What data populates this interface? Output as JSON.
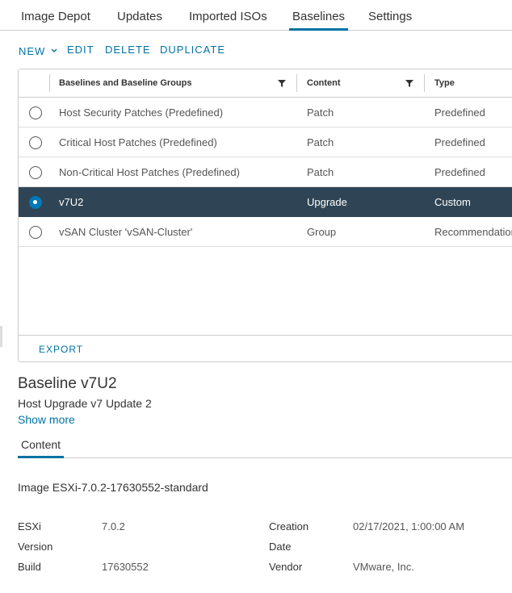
{
  "tabs": [
    {
      "label": "Image Depot",
      "active": false
    },
    {
      "label": "Updates",
      "active": false
    },
    {
      "label": "Imported ISOs",
      "active": false
    },
    {
      "label": "Baselines",
      "active": true
    },
    {
      "label": "Settings",
      "active": false
    }
  ],
  "toolbar": {
    "new_label": "NEW",
    "edit_label": "EDIT",
    "delete_label": "DELETE",
    "duplicate_label": "DUPLICATE"
  },
  "grid": {
    "columns": [
      "Baselines and Baseline Groups",
      "Content",
      "Type"
    ],
    "rows": [
      {
        "name": "Host Security Patches (Predefined)",
        "content": "Patch",
        "type": "Predefined",
        "selected": false
      },
      {
        "name": "Critical Host Patches (Predefined)",
        "content": "Patch",
        "type": "Predefined",
        "selected": false
      },
      {
        "name": "Non-Critical Host Patches (Predefined)",
        "content": "Patch",
        "type": "Predefined",
        "selected": false
      },
      {
        "name": "v7U2",
        "content": "Upgrade",
        "type": "Custom",
        "selected": true
      },
      {
        "name": "vSAN Cluster 'vSAN-Cluster'",
        "content": "Group",
        "type": "Recommendation",
        "selected": false
      }
    ],
    "export_label": "EXPORT"
  },
  "detail": {
    "title": "Baseline v7U2",
    "subtitle": "Host Upgrade v7 Update 2",
    "show_more": "Show more",
    "content_tab": "Content",
    "image": "Image ESXi-7.0.2-17630552-standard",
    "esxi_version_label_1": "ESXi",
    "esxi_version_label_2": "Version",
    "esxi_version": "7.0.2",
    "build_label": "Build",
    "build": "17630552",
    "creation_date_label_1": "Creation",
    "creation_date_label_2": "Date",
    "creation_date": "02/17/2021, 1:00:00 AM",
    "vendor_label": "Vendor",
    "vendor": "VMware, Inc."
  },
  "colors": {
    "accent": "#0072a3",
    "selected_row": "#2f4555",
    "radio_selected": "#0079b8"
  }
}
